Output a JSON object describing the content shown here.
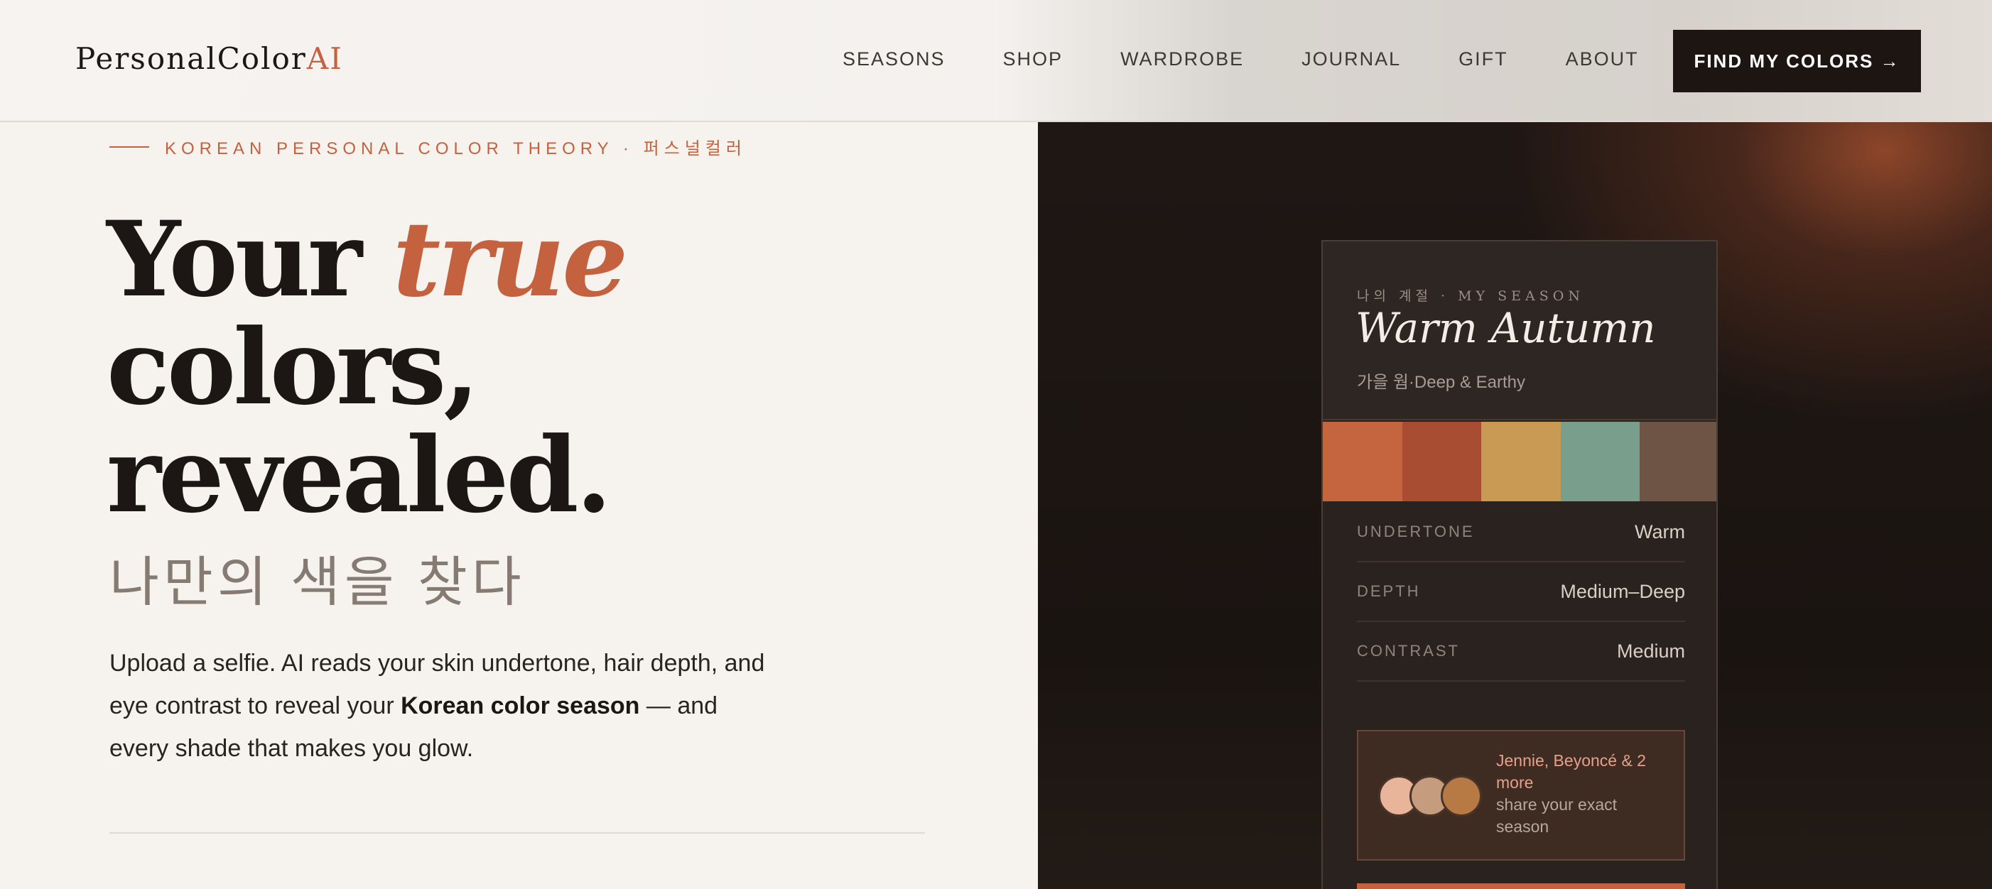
{
  "header": {
    "logo_main": "PersonalColor",
    "logo_accent": "AI",
    "nav": [
      "SEASONS",
      "SHOP",
      "WARDROBE",
      "JOURNAL",
      "GIFT",
      "ABOUT"
    ],
    "cta_label": "FIND MY COLORS →"
  },
  "hero": {
    "eyebrow": "KOREAN PERSONAL COLOR THEORY · 퍼스널컬러",
    "headline_1": "Your ",
    "headline_accent": "true",
    "headline_2": "colors,",
    "headline_3": "revealed.",
    "korean_subtitle": "나만의 색을 찾다",
    "desc_1": "Upload a selfie. AI reads your skin undertone, hair depth, and eye contrast to reveal your ",
    "desc_bold": "Korean color season",
    "desc_2": " — and every shade that makes you glow."
  },
  "card": {
    "label": "나의 계절 · MY SEASON",
    "title": "Warm Autumn",
    "subtitle": "가을 웜·Deep & Earthy",
    "swatches": [
      "#c5653f",
      "#a84d32",
      "#c99a54",
      "#7a9e8c",
      "#6e5444"
    ],
    "rows": [
      {
        "label": "UNDERTONE",
        "value": "Warm"
      },
      {
        "label": "DEPTH",
        "value": "Medium–Deep"
      },
      {
        "label": "CONTRAST",
        "value": "Medium"
      }
    ],
    "social_names": "Jennie, Beyoncé & 2 more",
    "social_text": "share your exact season",
    "avatar_colors": [
      "#e8b49a",
      "#c69c7e",
      "#b87a45"
    ]
  }
}
